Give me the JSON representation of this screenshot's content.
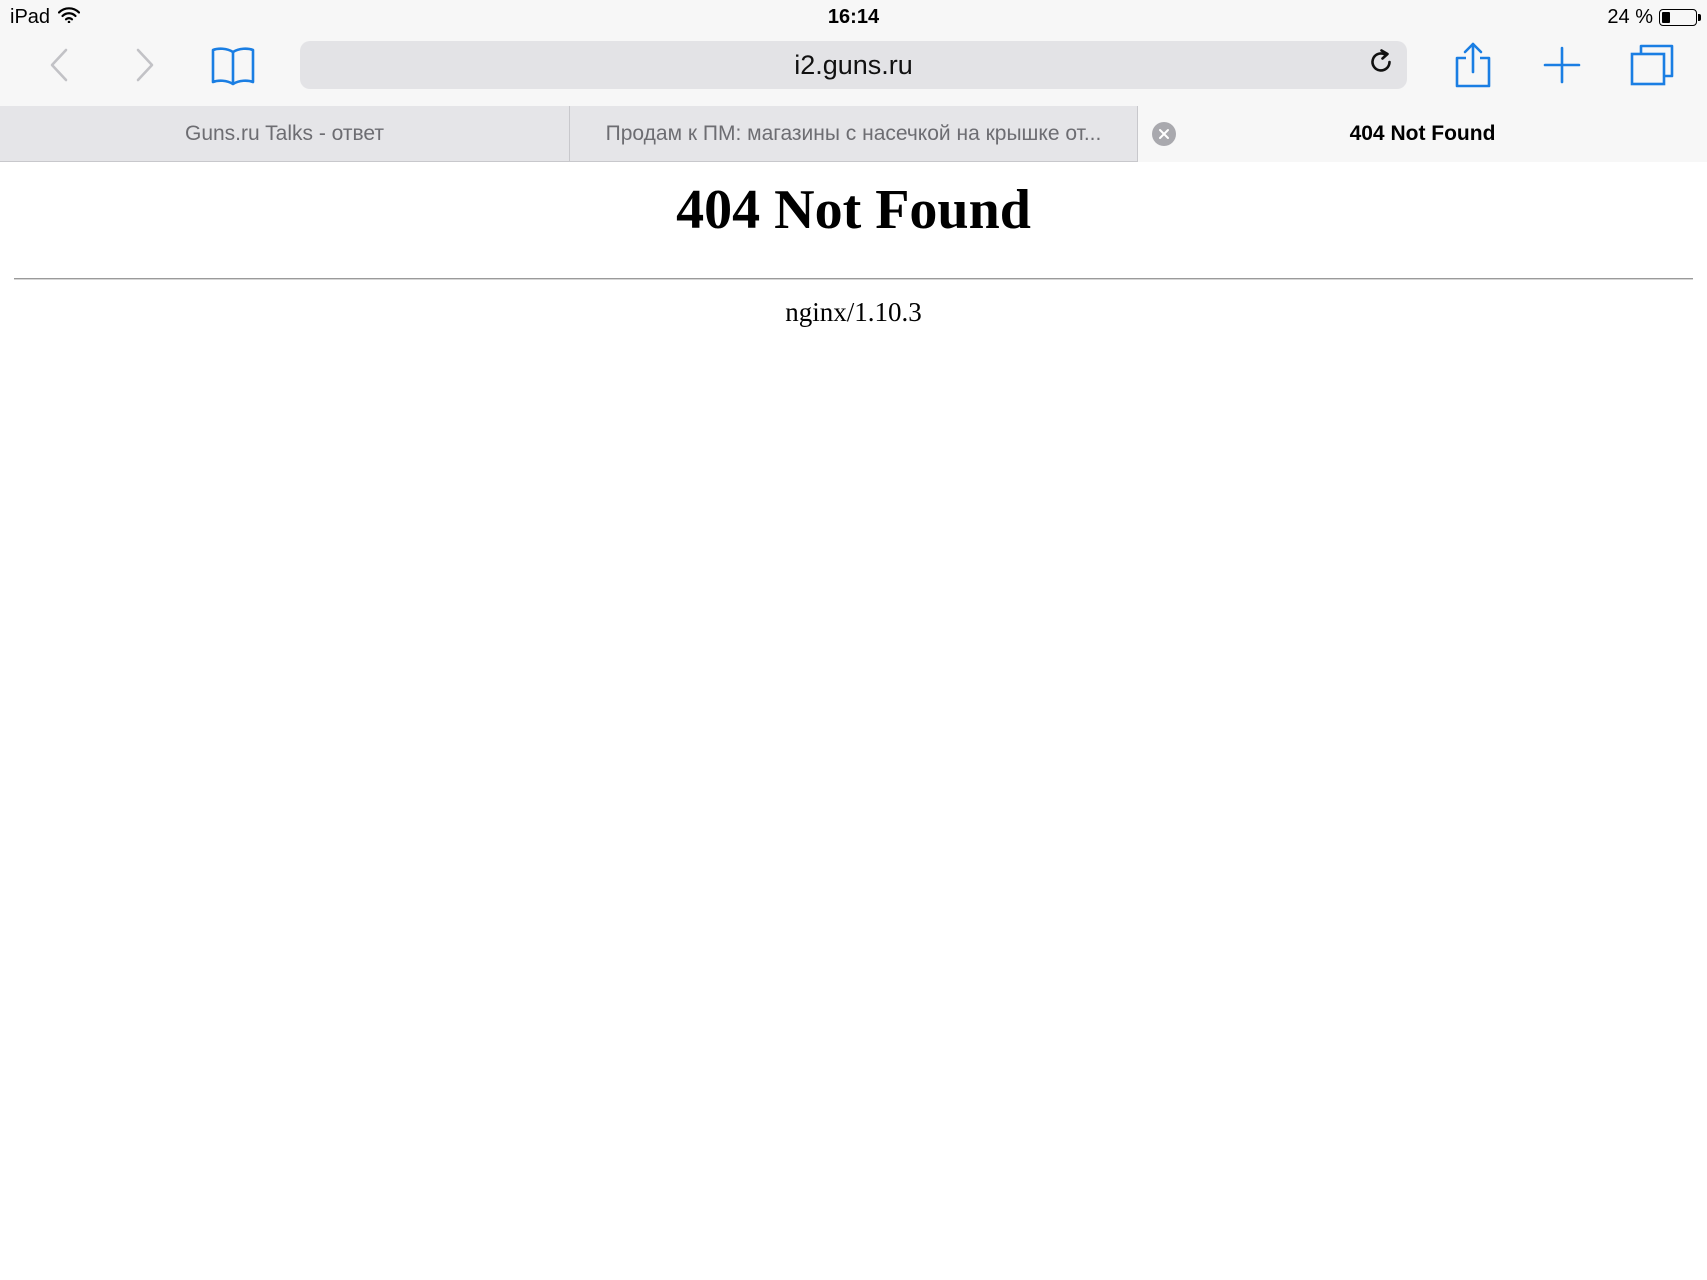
{
  "status_bar": {
    "device": "iPad",
    "time": "16:14",
    "battery_text": "24 %",
    "battery_level_percent": 24,
    "wifi_icon": "wifi-icon"
  },
  "toolbar": {
    "url": "i2.guns.ru",
    "accent_color": "#1a7ee3",
    "icons": {
      "back": "chevron-left-icon",
      "forward": "chevron-right-icon",
      "bookmarks": "book-icon",
      "reload": "reload-icon",
      "share": "share-icon",
      "new_tab": "plus-icon",
      "tabs": "tabs-icon"
    }
  },
  "tabs": [
    {
      "label": "Guns.ru Talks - ответ",
      "active": false
    },
    {
      "label": "Продам к ПМ: магазины с насечкой на крышке от...",
      "active": false
    },
    {
      "label": "404 Not Found",
      "active": true
    }
  ],
  "page": {
    "heading": "404 Not Found",
    "server": "nginx/1.10.3"
  }
}
